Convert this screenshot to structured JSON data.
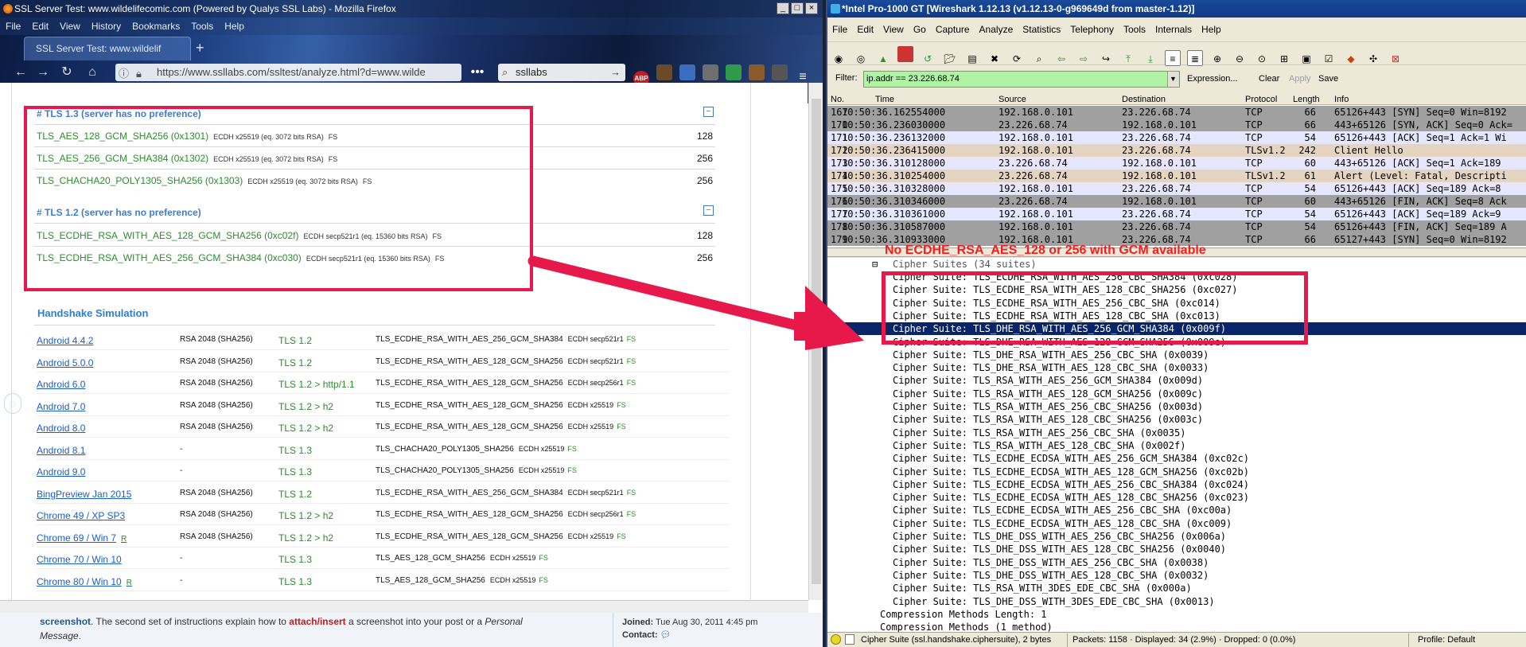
{
  "firefox": {
    "title": "SSL Server Test: www.wildelifecomic.com (Powered by Qualys SSL Labs) - Mozilla Firefox",
    "menu": [
      "File",
      "Edit",
      "View",
      "History",
      "Bookmarks",
      "Tools",
      "Help"
    ],
    "tab_title": "SSL Server Test: www.wildelif",
    "url": "https://www.ssllabs.com/ssltest/analyze.html?d=www.wilde",
    "search_value": "ssllabs",
    "adblock_badge": "ABP"
  },
  "ssl": {
    "tls13_title": "# TLS 1.3 (server has no preference)",
    "tls13": [
      {
        "name": "TLS_AES_128_GCM_SHA256 (0x1301)",
        "detail": "ECDH x25519 (eq. 3072 bits RSA)",
        "fs": "FS",
        "bits": "128"
      },
      {
        "name": "TLS_AES_256_GCM_SHA384 (0x1302)",
        "detail": "ECDH x25519 (eq. 3072 bits RSA)",
        "fs": "FS",
        "bits": "256"
      },
      {
        "name": "TLS_CHACHA20_POLY1305_SHA256 (0x1303)",
        "detail": "ECDH x25519 (eq. 3072 bits RSA)",
        "fs": "FS",
        "bits": "256"
      }
    ],
    "tls12_title": "# TLS 1.2 (server has no preference)",
    "tls12": [
      {
        "name": "TLS_ECDHE_RSA_WITH_AES_128_GCM_SHA256 (0xc02f)",
        "detail": "ECDH secp521r1 (eq. 15360 bits RSA)",
        "fs": "FS",
        "bits": "128"
      },
      {
        "name": "TLS_ECDHE_RSA_WITH_AES_256_GCM_SHA384 (0xc030)",
        "detail": "ECDH secp521r1 (eq. 15360 bits RSA)",
        "fs": "FS",
        "bits": "256"
      }
    ],
    "handshake_title": "Handshake Simulation",
    "handshake": [
      {
        "client": "Android 4.4.2",
        "r": "",
        "key": "RSA 2048 (SHA256)",
        "proto": "TLS 1.2",
        "suite": "TLS_ECDHE_RSA_WITH_AES_256_GCM_SHA384",
        "ecdh": "ECDH secp521r1",
        "fs": "FS"
      },
      {
        "client": "Android 5.0.0",
        "r": "",
        "key": "RSA 2048 (SHA256)",
        "proto": "TLS 1.2",
        "suite": "TLS_ECDHE_RSA_WITH_AES_128_GCM_SHA256",
        "ecdh": "ECDH secp521r1",
        "fs": "FS"
      },
      {
        "client": "Android 6.0",
        "r": "",
        "key": "RSA 2048 (SHA256)",
        "proto": "TLS 1.2 > http/1.1",
        "suite": "TLS_ECDHE_RSA_WITH_AES_128_GCM_SHA256",
        "ecdh": "ECDH secp256r1",
        "fs": "FS"
      },
      {
        "client": "Android 7.0",
        "r": "",
        "key": "RSA 2048 (SHA256)",
        "proto": "TLS 1.2 > h2",
        "suite": "TLS_ECDHE_RSA_WITH_AES_128_GCM_SHA256",
        "ecdh": "ECDH x25519",
        "fs": "FS"
      },
      {
        "client": "Android 8.0",
        "r": "",
        "key": "RSA 2048 (SHA256)",
        "proto": "TLS 1.2 > h2",
        "suite": "TLS_ECDHE_RSA_WITH_AES_128_GCM_SHA256",
        "ecdh": "ECDH x25519",
        "fs": "FS"
      },
      {
        "client": "Android 8.1",
        "r": "",
        "key": "-",
        "proto": "TLS 1.3",
        "suite": "TLS_CHACHA20_POLY1305_SHA256",
        "ecdh": "ECDH x25519",
        "fs": "FS"
      },
      {
        "client": "Android 9.0",
        "r": "",
        "key": "-",
        "proto": "TLS 1.3",
        "suite": "TLS_CHACHA20_POLY1305_SHA256",
        "ecdh": "ECDH x25519",
        "fs": "FS"
      },
      {
        "client": "BingPreview Jan 2015",
        "r": "",
        "key": "RSA 2048 (SHA256)",
        "proto": "TLS 1.2",
        "suite": "TLS_ECDHE_RSA_WITH_AES_256_GCM_SHA384",
        "ecdh": "ECDH secp521r1",
        "fs": "FS"
      },
      {
        "client": "Chrome 49 / XP SP3",
        "r": "",
        "key": "RSA 2048 (SHA256)",
        "proto": "TLS 1.2 > h2",
        "suite": "TLS_ECDHE_RSA_WITH_AES_128_GCM_SHA256",
        "ecdh": "ECDH secp256r1",
        "fs": "FS"
      },
      {
        "client": "Chrome 69 / Win 7",
        "r": "R",
        "key": "RSA 2048 (SHA256)",
        "proto": "TLS 1.2 > h2",
        "suite": "TLS_ECDHE_RSA_WITH_AES_128_GCM_SHA256",
        "ecdh": "ECDH x25519",
        "fs": "FS"
      },
      {
        "client": "Chrome 70 / Win 10",
        "r": "",
        "key": "-",
        "proto": "TLS 1.3",
        "suite": "TLS_AES_128_GCM_SHA256",
        "ecdh": "ECDH x25519",
        "fs": "FS"
      },
      {
        "client": "Chrome 80 / Win 10",
        "r": "R",
        "key": "-",
        "proto": "TLS 1.3",
        "suite": "TLS_AES_128_GCM_SHA256",
        "ecdh": "ECDH x25519",
        "fs": "FS"
      }
    ]
  },
  "forum": {
    "text_1": "screenshot",
    "text_2": ". The second set of instructions explain how to ",
    "text_3": "attach/insert",
    "text_4": " a screenshot into your post or a ",
    "text_5": "Personal",
    "text_6": "Message",
    "text_7": ".",
    "joined_label": "Joined:",
    "joined_value": "Tue Aug 30, 2011 4:45 pm",
    "contact_label": "Contact:"
  },
  "wireshark": {
    "title": "*Intel Pro-1000 GT   [Wireshark 1.12.13 (v1.12.13-0-g969649d from master-1.12)]",
    "menu": [
      "File",
      "Edit",
      "View",
      "Go",
      "Capture",
      "Analyze",
      "Statistics",
      "Telephony",
      "Tools",
      "Internals",
      "Help"
    ],
    "filter_label": "Filter:",
    "filter_value": "ip.addr == 23.226.68.74",
    "filter_buttons": {
      "expression": "Expression...",
      "clear": "Clear",
      "apply": "Apply",
      "save": "Save"
    },
    "columns": [
      "No.",
      "Time",
      "Source",
      "Destination",
      "Protocol",
      "Length",
      "Info"
    ],
    "packets": [
      {
        "no": "167",
        "time": "10:50:36.162554000",
        "src": "192.168.0.101",
        "dst": "23.226.68.74",
        "proto": "TCP",
        "len": "66",
        "info": "65126+443 [SYN] Seq=0 Win=8192",
        "bg": "#a0a0a0",
        "fg": "#000000"
      },
      {
        "no": "170",
        "time": "10:50:36.236030000",
        "src": "23.226.68.74",
        "dst": "192.168.0.101",
        "proto": "TCP",
        "len": "66",
        "info": "443+65126 [SYN, ACK] Seq=0 Ack=",
        "bg": "#a0a0a0",
        "fg": "#000000"
      },
      {
        "no": "171",
        "time": "10:50:36.236132000",
        "src": "192.168.0.101",
        "dst": "23.226.68.74",
        "proto": "TCP",
        "len": "54",
        "info": "65126+443 [ACK] Seq=1 Ack=1 Wi",
        "bg": "#e7e6ff",
        "fg": "#000000"
      },
      {
        "no": "172",
        "time": "10:50:36.236415000",
        "src": "192.168.0.101",
        "dst": "23.226.68.74",
        "proto": "TLSv1.2",
        "len": "242",
        "info": "Client Hello",
        "bg": "#e4d4c0",
        "fg": "#000000"
      },
      {
        "no": "173",
        "time": "10:50:36.310128000",
        "src": "23.226.68.74",
        "dst": "192.168.0.101",
        "proto": "TCP",
        "len": "60",
        "info": "443+65126 [ACK] Seq=1 Ack=189",
        "bg": "#e7e6ff",
        "fg": "#000000"
      },
      {
        "no": "174",
        "time": "10:50:36.310254000",
        "src": "23.226.68.74",
        "dst": "192.168.0.101",
        "proto": "TLSv1.2",
        "len": "61",
        "info": "Alert (Level: Fatal, Descripti",
        "bg": "#e4d4c0",
        "fg": "#000000"
      },
      {
        "no": "175",
        "time": "10:50:36.310328000",
        "src": "192.168.0.101",
        "dst": "23.226.68.74",
        "proto": "TCP",
        "len": "54",
        "info": "65126+443 [ACK] Seq=189 Ack=8",
        "bg": "#e7e6ff",
        "fg": "#000000"
      },
      {
        "no": "176",
        "time": "10:50:36.310346000",
        "src": "23.226.68.74",
        "dst": "192.168.0.101",
        "proto": "TCP",
        "len": "60",
        "info": "443+65126 [FIN, ACK] Seq=8 Ack",
        "bg": "#a0a0a0",
        "fg": "#000000"
      },
      {
        "no": "177",
        "time": "10:50:36.310361000",
        "src": "192.168.0.101",
        "dst": "23.226.68.74",
        "proto": "TCP",
        "len": "54",
        "info": "65126+443 [ACK] Seq=189 Ack=9",
        "bg": "#e7e6ff",
        "fg": "#000000"
      },
      {
        "no": "178",
        "time": "10:50:36.310587000",
        "src": "192.168.0.101",
        "dst": "23.226.68.74",
        "proto": "TCP",
        "len": "54",
        "info": "65126+443 [FIN, ACK] Seq=189 A",
        "bg": "#a0a0a0",
        "fg": "#000000"
      },
      {
        "no": "179",
        "time": "10:50:36.310933000",
        "src": "192.168.0.101",
        "dst": "23.226.68.74",
        "proto": "TCP",
        "len": "66",
        "info": "65127+443 [SYN] Seq=0 Win=8192",
        "bg": "#a0a0a0",
        "fg": "#000000"
      }
    ],
    "annotation": "No ECDHE_RSA_AES_128 or 256 with GCM available",
    "cipher_header": "Cipher Suites (34 suites)",
    "cipher_suites": [
      "Cipher Suite: TLS_ECDHE_RSA_WITH_AES_256_CBC_SHA384 (0xc028)",
      "Cipher Suite: TLS_ECDHE_RSA_WITH_AES_128_CBC_SHA256 (0xc027)",
      "Cipher Suite: TLS_ECDHE_RSA_WITH_AES_256_CBC_SHA (0xc014)",
      "Cipher Suite: TLS_ECDHE_RSA_WITH_AES_128_CBC_SHA (0xc013)",
      "Cipher Suite: TLS_DHE_RSA_WITH_AES_256_GCM_SHA384 (0x009f)",
      "Cipher Suite: TLS_DHE_RSA_WITH_AES_128_GCM_SHA256 (0x009e)",
      "Cipher Suite: TLS_DHE_RSA_WITH_AES_256_CBC_SHA (0x0039)",
      "Cipher Suite: TLS_DHE_RSA_WITH_AES_128_CBC_SHA (0x0033)",
      "Cipher Suite: TLS_RSA_WITH_AES_256_GCM_SHA384 (0x009d)",
      "Cipher Suite: TLS_RSA_WITH_AES_128_GCM_SHA256 (0x009c)",
      "Cipher Suite: TLS_RSA_WITH_AES_256_CBC_SHA256 (0x003d)",
      "Cipher Suite: TLS_RSA_WITH_AES_128_CBC_SHA256 (0x003c)",
      "Cipher Suite: TLS_RSA_WITH_AES_256_CBC_SHA (0x0035)",
      "Cipher Suite: TLS_RSA_WITH_AES_128_CBC_SHA (0x002f)",
      "Cipher Suite: TLS_ECDHE_ECDSA_WITH_AES_256_GCM_SHA384 (0xc02c)",
      "Cipher Suite: TLS_ECDHE_ECDSA_WITH_AES_128_GCM_SHA256 (0xc02b)",
      "Cipher Suite: TLS_ECDHE_ECDSA_WITH_AES_256_CBC_SHA384 (0xc024)",
      "Cipher Suite: TLS_ECDHE_ECDSA_WITH_AES_128_CBC_SHA256 (0xc023)",
      "Cipher Suite: TLS_ECDHE_ECDSA_WITH_AES_256_CBC_SHA (0xc00a)",
      "Cipher Suite: TLS_ECDHE_ECDSA_WITH_AES_128_CBC_SHA (0xc009)",
      "Cipher Suite: TLS_DHE_DSS_WITH_AES_256_CBC_SHA256 (0x006a)",
      "Cipher Suite: TLS_DHE_DSS_WITH_AES_128_CBC_SHA256 (0x0040)",
      "Cipher Suite: TLS_DHE_DSS_WITH_AES_256_CBC_SHA (0x0038)",
      "Cipher Suite: TLS_DHE_DSS_WITH_AES_128_CBC_SHA (0x0032)",
      "Cipher Suite: TLS_RSA_WITH_3DES_EDE_CBC_SHA (0x000a)",
      "Cipher Suite: TLS_DHE_DSS_WITH_3DES_EDE_CBC_SHA (0x0013)"
    ],
    "compression": "Compression Methods Length: 1",
    "compression_methods": "Compression Methods (1 method)",
    "status": {
      "field": "Cipher Suite (ssl.handshake.ciphersuite), 2 bytes",
      "packets": "Packets: 1158 · Displayed: 34 (2.9%) · Dropped: 0 (0.0%)",
      "profile": "Profile: Default"
    }
  },
  "colors": {
    "highlight": "#e6194a",
    "tls_green": "#2d8c2d",
    "ssl_blue": "#3e7dd6",
    "filter_bg": "#b0f3a4",
    "selected_row": "#0a246a"
  }
}
